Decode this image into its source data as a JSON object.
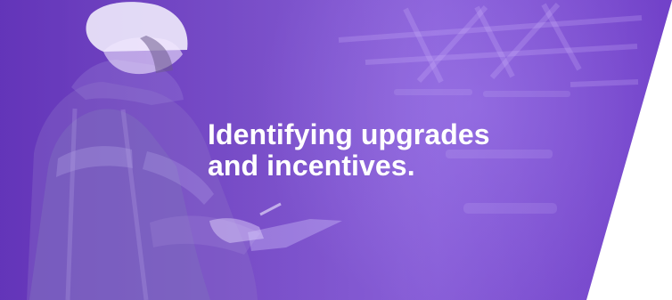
{
  "banner": {
    "headline": "Identifying upgrades\nand incentives.",
    "image_subject": "worker with hard hat and clipboard in warehouse",
    "primary_color": "#6b3cc2",
    "background_color": "#ffffff"
  }
}
